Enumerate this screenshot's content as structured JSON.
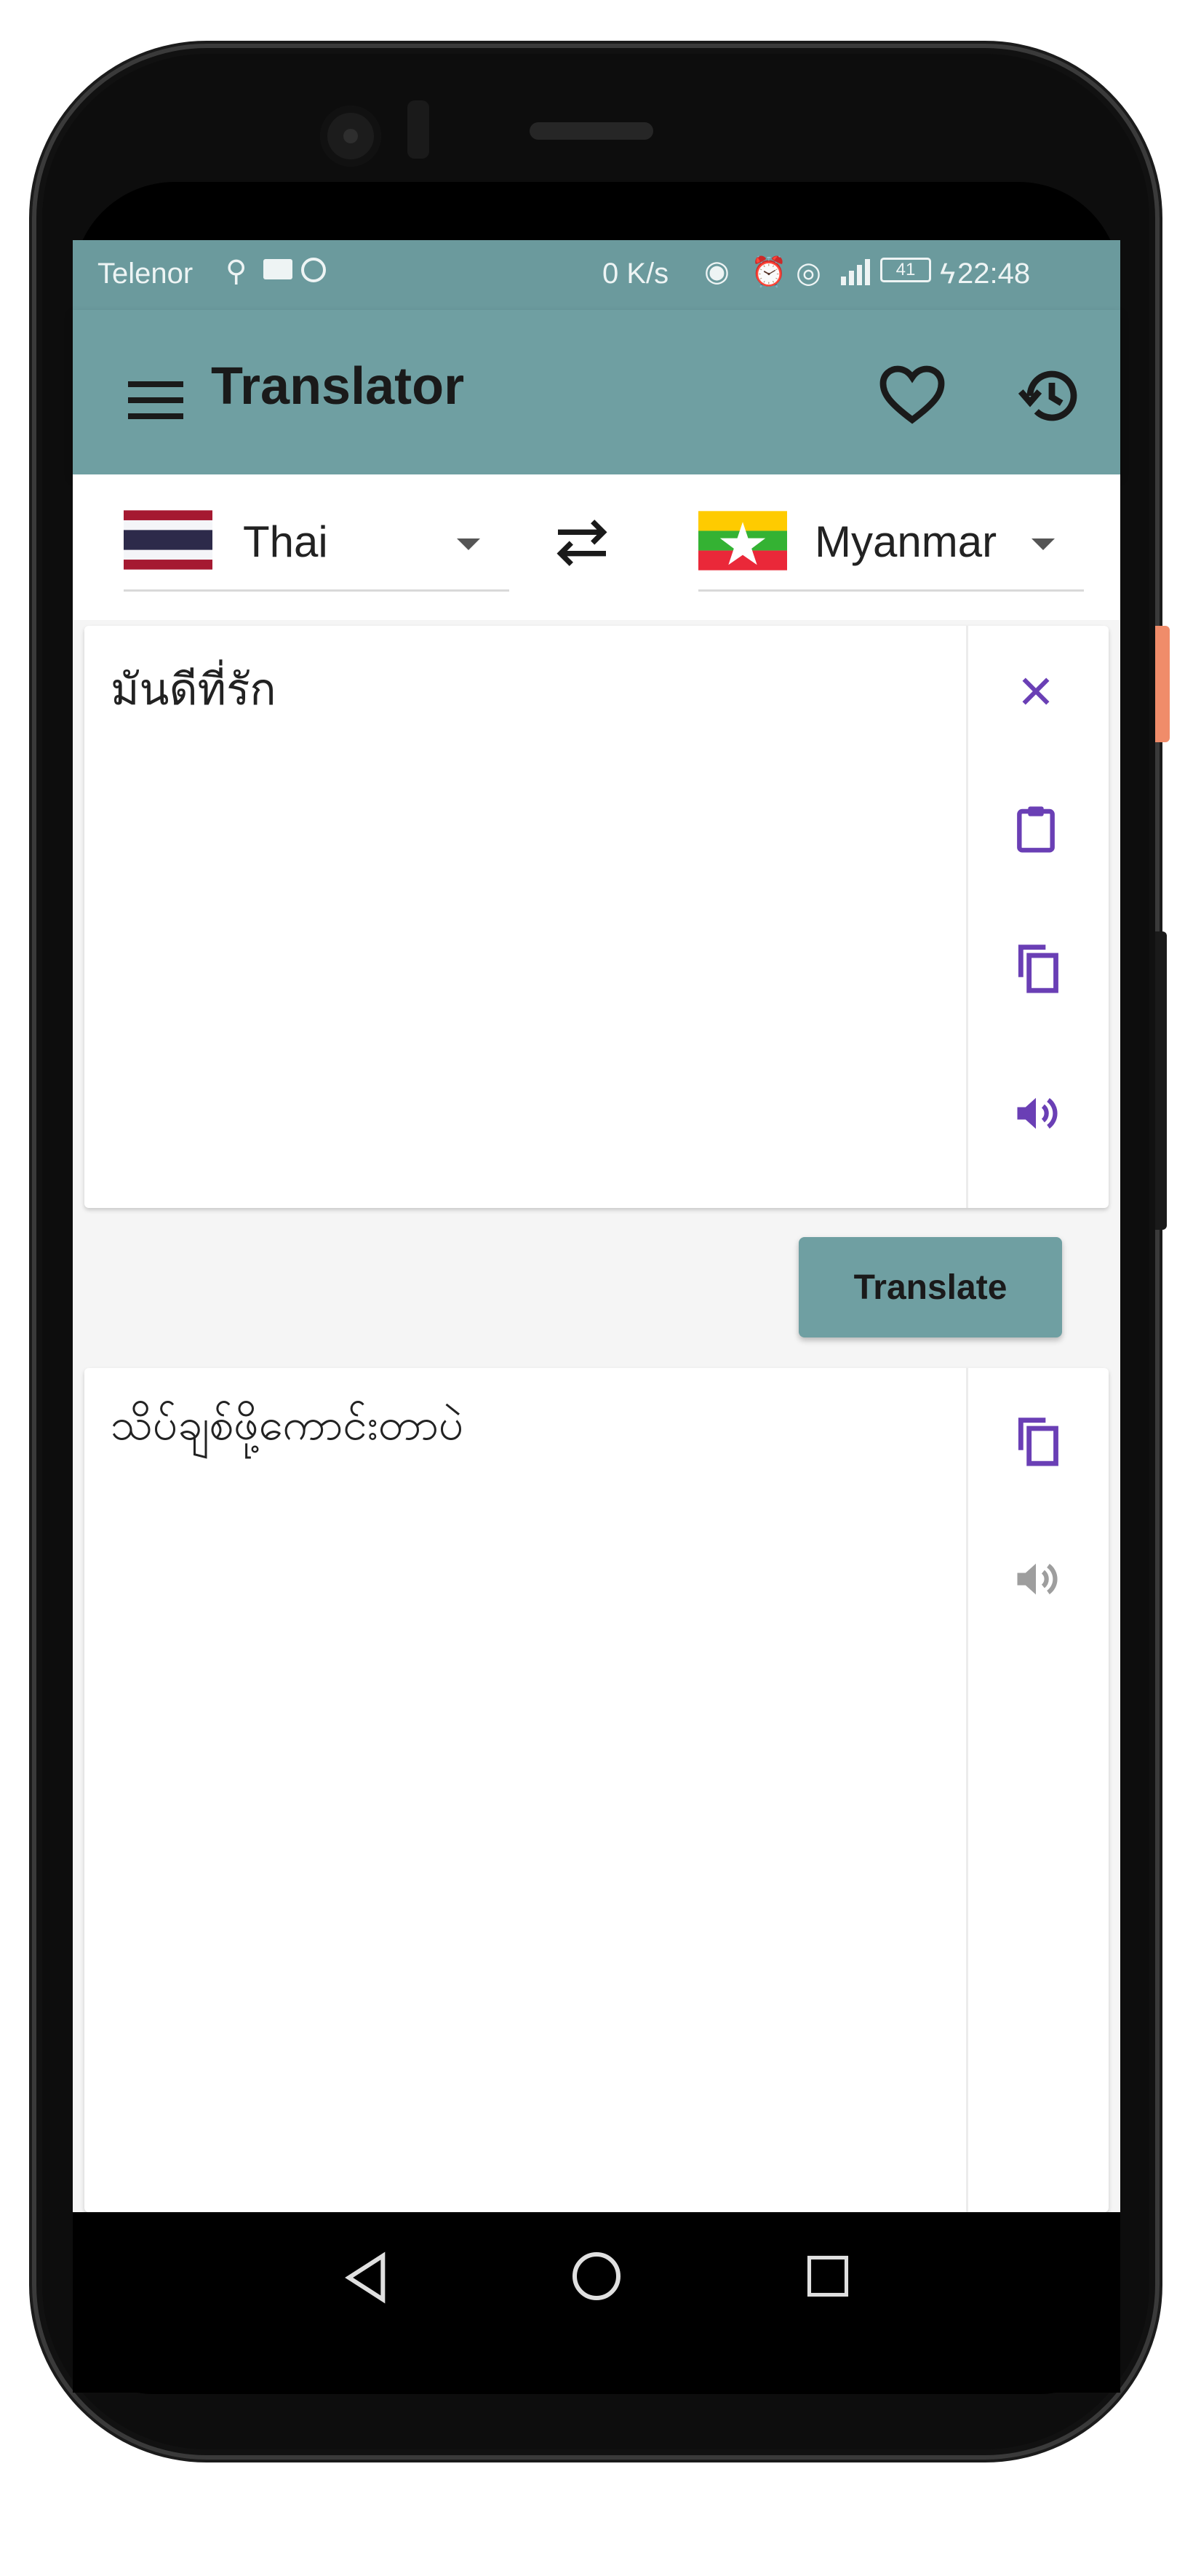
{
  "status_bar": {
    "carrier": "Telenor",
    "speed": "0 K/s",
    "battery": "41",
    "time": "22:48"
  },
  "app_bar": {
    "title": "Translator",
    "menu_icon": "menu-icon",
    "favorite_icon": "heart-icon",
    "history_icon": "history-icon"
  },
  "languages": {
    "source": "Thai",
    "target": "Myanmar",
    "swap_icon": "swap-icon"
  },
  "input": {
    "text": "มันดีที่รัก",
    "actions": [
      "close-icon",
      "paste-icon",
      "copy-icon",
      "speaker-icon"
    ]
  },
  "translate_button": {
    "label": "Translate"
  },
  "output": {
    "text": "သိပ်ချစ်ဖို့ကောင်းတာပဲ",
    "actions": [
      "copy-icon",
      "speaker-icon"
    ]
  },
  "colors": {
    "accent": "#6f9fa2",
    "icon_purple": "#6a3fb5",
    "icon_disabled": "#9e9e9e"
  }
}
